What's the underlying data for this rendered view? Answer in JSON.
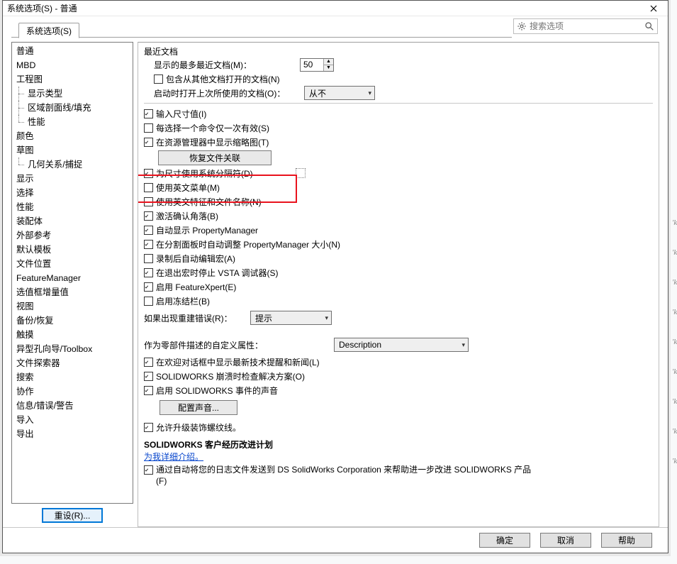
{
  "window": {
    "title": "系统选项(S) - 普通",
    "close_aria": "close"
  },
  "tabs": {
    "system_options": "系统选项(S)"
  },
  "search": {
    "placeholder": "搜索选项"
  },
  "sidebar": {
    "items": [
      {
        "label": "普通",
        "level": 0
      },
      {
        "label": "MBD",
        "level": 0
      },
      {
        "label": "工程图",
        "level": 0
      },
      {
        "label": "显示类型",
        "level": 1
      },
      {
        "label": "区域剖面线/填充",
        "level": 1
      },
      {
        "label": "性能",
        "level": 1,
        "last": true
      },
      {
        "label": "颜色",
        "level": 0
      },
      {
        "label": "草图",
        "level": 0
      },
      {
        "label": "几何关系/捕捉",
        "level": 1,
        "last": true
      },
      {
        "label": "显示",
        "level": 0
      },
      {
        "label": "选择",
        "level": 0
      },
      {
        "label": "性能",
        "level": 0
      },
      {
        "label": "装配体",
        "level": 0
      },
      {
        "label": "外部参考",
        "level": 0
      },
      {
        "label": "默认模板",
        "level": 0
      },
      {
        "label": "文件位置",
        "level": 0
      },
      {
        "label": "FeatureManager",
        "level": 0
      },
      {
        "label": "选值框增量值",
        "level": 0
      },
      {
        "label": "视图",
        "level": 0
      },
      {
        "label": "备份/恢复",
        "level": 0
      },
      {
        "label": "触摸",
        "level": 0
      },
      {
        "label": "异型孔向导/Toolbox",
        "level": 0
      },
      {
        "label": "文件探索器",
        "level": 0
      },
      {
        "label": "搜索",
        "level": 0
      },
      {
        "label": "协作",
        "level": 0
      },
      {
        "label": "信息/错误/警告",
        "level": 0
      },
      {
        "label": "导入",
        "level": 0
      },
      {
        "label": "导出",
        "level": 0
      }
    ],
    "reset_label": "重设(R)..."
  },
  "content": {
    "recent_docs_title": "最近文档",
    "max_recent_label": "显示的最多最近文档(M)：",
    "max_recent_value": "50",
    "include_other_docs": "包含从其他文档打开的文档(N)",
    "open_last_label": "启动时打开上次所使用的文档(O)：",
    "open_last_value": "从不",
    "input_dim": "输入尺寸值(I)",
    "single_cmd": "每选择一个命令仅一次有效(S)",
    "show_thumb": "在资源管理器中显示缩略图(T)",
    "restore_assoc": "恢复文件关联",
    "sys_sep": "为尺寸使用系统分隔符(D)",
    "en_menu": "使用英文菜单(M)",
    "en_feat": "使用英文特征和文件名称(N)",
    "confirm_corner": "激活确认角落(B)",
    "auto_pm": "自动显示 PropertyManager",
    "auto_resize_pm": "在分割面板时自动调整 PropertyManager 大小(N)",
    "auto_edit_macro": "录制后自动编辑宏(A)",
    "stop_vsta": "在退出宏时停止 VSTA 调试器(S)",
    "enable_fx": "启用 FeatureXpert(E)",
    "enable_freeze": "启用冻结栏(B)",
    "rebuild_err_label": "如果出现重建错误(R)：",
    "rebuild_err_value": "提示",
    "custom_prop_label": "作为零部件描述的自定义属性：",
    "custom_prop_value": "Description",
    "show_news": "在欢迎对话框中显示最新技术提醒和新闻(L)",
    "check_crash": "SOLIDWORKS 崩溃时检查解决方案(O)",
    "enable_sound": "启用 SOLIDWORKS 事件的声音",
    "config_sound": "配置声音...",
    "allow_cosmetic": "允许升级装饰螺纹线。",
    "cei_title": "SOLIDWORKS 客户经历改进计划",
    "cei_link": "为我详细介绍。",
    "cei_checkbox": "通过自动将您的日志文件发送到 DS SolidWorks Corporation 来帮助进一步改进 SOLIDWORKS 产品(F)"
  },
  "footer": {
    "ok": "确定",
    "cancel": "取消",
    "help": "帮助"
  },
  "ghosts": [
    "'k",
    "'k",
    "'k",
    "'k",
    "'k",
    "'k",
    "'k",
    "'k",
    "'k"
  ]
}
